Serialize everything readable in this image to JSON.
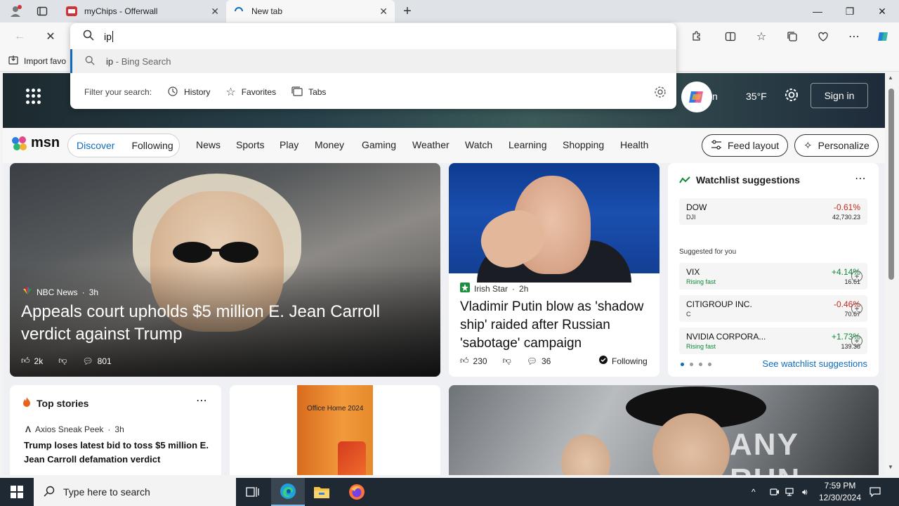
{
  "tabs": [
    {
      "title": "myChips - Offerwall"
    },
    {
      "title": "New tab"
    }
  ],
  "omnibox": {
    "value": "ip",
    "suggestion_query": "ip",
    "suggestion_source": "- Bing Search",
    "filter_label": "Filter your search:",
    "filters": [
      "History",
      "Favorites",
      "Tabs"
    ]
  },
  "favorites_bar": {
    "import_label": "Import favo"
  },
  "msn": {
    "header": {
      "signin_partial": "n",
      "temperature": "35°F",
      "signin_button": "Sign in"
    },
    "logo": "msn",
    "segmented": {
      "discover": "Discover",
      "following": "Following"
    },
    "nav": [
      "News",
      "Sports",
      "Play",
      "Money",
      "Gaming",
      "Weather",
      "Watch",
      "Learning",
      "Shopping",
      "Health"
    ],
    "feed_layout": "Feed layout",
    "personalize": "Personalize",
    "hero": {
      "source": "NBC News",
      "age": "3h",
      "headline": "Appeals court upholds $5 million E. Jean Carroll verdict against Trump",
      "likes": "2k",
      "comments": "801"
    },
    "story2": {
      "source": "Irish Star",
      "age": "2h",
      "headline": "Vladimir Putin blow as 'shadow ship' raided after Russian 'sabotage' campaign",
      "likes": "230",
      "comments": "36",
      "following": "Following"
    },
    "watchlist": {
      "title": "Watchlist suggestions",
      "suggested_label": "Suggested for you",
      "see_link": "See watchlist suggestions",
      "items": [
        {
          "name": "DOW",
          "sub": "DJI",
          "change": "-0.61%",
          "price": "42,730.23"
        },
        {
          "name": "VIX",
          "sub": "Rising fast",
          "change": "+4.14%",
          "price": "16.61"
        },
        {
          "name": "CITIGROUP INC.",
          "sub": "C",
          "change": "-0.46%",
          "price": "70.67"
        },
        {
          "name": "NVIDIA CORPORA...",
          "sub": "Rising fast",
          "change": "+1.73%",
          "price": "139.38"
        }
      ]
    },
    "top_stories": {
      "title": "Top stories",
      "source": "Axios Sneak Peek",
      "age": "3h",
      "headline": "Trump loses latest bid to toss $5 million E. Jean Carroll defamation verdict"
    },
    "ad": {
      "label": "Office Home 2024"
    },
    "watermark": "ANY RUN"
  },
  "taskbar": {
    "search_placeholder": "Type here to search",
    "time": "7:59 PM",
    "date": "12/30/2024"
  }
}
